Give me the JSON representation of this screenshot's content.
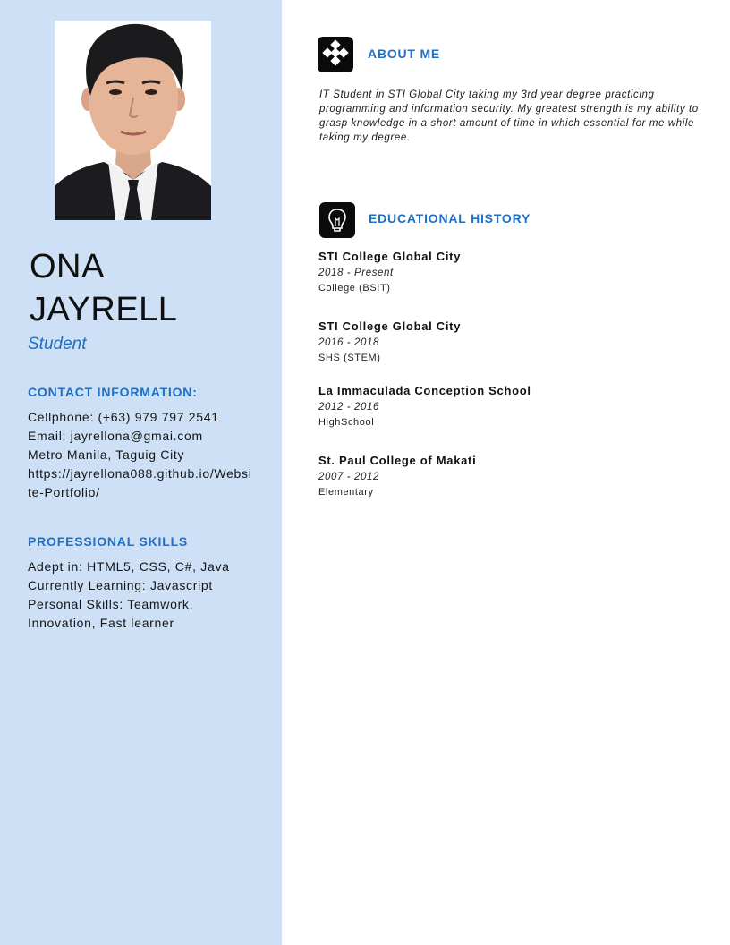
{
  "profile": {
    "first_name": "ONA",
    "last_name": "JAYRELL",
    "role": "Student"
  },
  "contact": {
    "heading": "CONTACT INFORMATION:",
    "lines": [
      "Cellphone: (+63) 979 797 2541",
      "Email: jayrellona@gmai.com",
      "Metro Manila, Taguig City",
      "https://jayrellona088.github.io/Website-Portfolio/"
    ]
  },
  "skills": {
    "heading": "PROFESSIONAL SKILLS",
    "lines": [
      "Adept in: HTML5, CSS, C#, Java",
      "Currently Learning: Javascript",
      "Personal Skills: Teamwork, Innovation, Fast learner"
    ]
  },
  "about": {
    "title": "ABOUT ME",
    "icon": "diamond-dots-icon",
    "text": "IT Student in STI Global City taking my 3rd year degree practicing programming and information security. My greatest strength is my ability to grasp knowledge in a short amount of time in which essential for me while taking my degree."
  },
  "education": {
    "title": "EDUCATIONAL HISTORY",
    "icon": "lightbulb-icon",
    "entries": [
      {
        "school": "STI College Global City",
        "years": "2018 - Present",
        "level": "College (BSIT)"
      },
      {
        "school": "STI College Global City",
        "years": "2016 - 2018",
        "level": "SHS (STEM)"
      },
      {
        "school": "La Immaculada Conception School",
        "years": "2012 - 2016",
        "level": "HighSchool"
      },
      {
        "school": "St. Paul College of Makati",
        "years": "2007 - 2012",
        "level": "Elementary"
      }
    ]
  },
  "colors": {
    "sidebar_bg": "#cde0f5",
    "accent": "#1f6fc4"
  }
}
